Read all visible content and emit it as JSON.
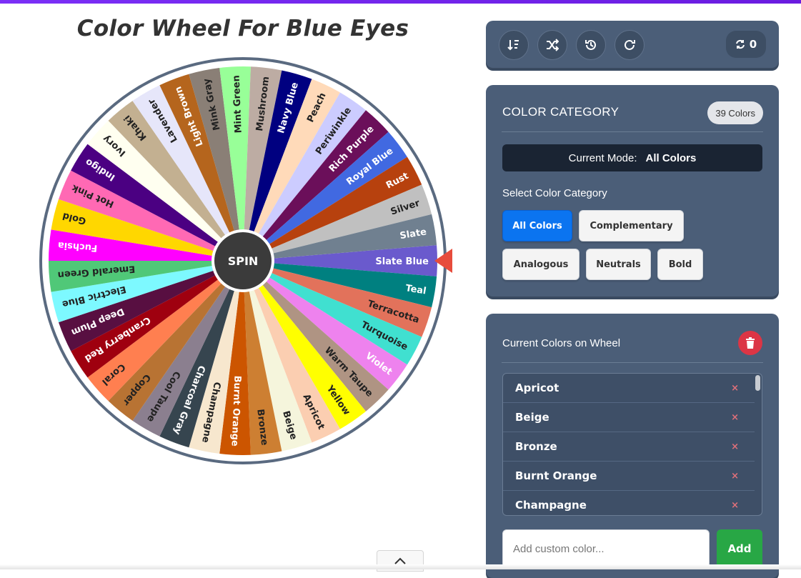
{
  "page": {
    "title": "Color Wheel For Blue Eyes"
  },
  "wheel": {
    "spin_label": "SPIN",
    "segments": [
      {
        "label": "Slate Blue",
        "color": "#6a5acd",
        "text": "#ffffff"
      },
      {
        "label": "Teal",
        "color": "#008080",
        "text": "#ffffff"
      },
      {
        "label": "Terracotta",
        "color": "#e2725b",
        "text": "#222222"
      },
      {
        "label": "Turquoise",
        "color": "#40e0d0",
        "text": "#222222"
      },
      {
        "label": "Violet",
        "color": "#ee82ee",
        "text": "#ffffff"
      },
      {
        "label": "Warm Taupe",
        "color": "#af9483",
        "text": "#222222"
      },
      {
        "label": "Yellow",
        "color": "#ffff00",
        "text": "#222222"
      },
      {
        "label": "Apricot",
        "color": "#fbceb1",
        "text": "#222222"
      },
      {
        "label": "Beige",
        "color": "#f5f5dc",
        "text": "#222222"
      },
      {
        "label": "Bronze",
        "color": "#cd7f32",
        "text": "#222222"
      },
      {
        "label": "Burnt Orange",
        "color": "#cc5500",
        "text": "#ffffff"
      },
      {
        "label": "Champagne",
        "color": "#f7e7ce",
        "text": "#222222"
      },
      {
        "label": "Charcoal Gray",
        "color": "#36454f",
        "text": "#ffffff"
      },
      {
        "label": "Cool Taupe",
        "color": "#8b7f8f",
        "text": "#222222"
      },
      {
        "label": "Copper",
        "color": "#b87333",
        "text": "#222222"
      },
      {
        "label": "Coral",
        "color": "#ff7f50",
        "text": "#222222"
      },
      {
        "label": "Cranberry Red",
        "color": "#9f000f",
        "text": "#ffffff"
      },
      {
        "label": "Deep Plum",
        "color": "#580f41",
        "text": "#ffffff"
      },
      {
        "label": "Electric Blue",
        "color": "#7df9ff",
        "text": "#222222"
      },
      {
        "label": "Emerald Green",
        "color": "#50c878",
        "text": "#222222"
      },
      {
        "label": "Fuchsia",
        "color": "#ff00ff",
        "text": "#ffffff"
      },
      {
        "label": "Gold",
        "color": "#ffd700",
        "text": "#222222"
      },
      {
        "label": "Hot Pink",
        "color": "#ff69b4",
        "text": "#222222"
      },
      {
        "label": "Indigo",
        "color": "#4b0082",
        "text": "#ffffff"
      },
      {
        "label": "Ivory",
        "color": "#fffff0",
        "text": "#222222"
      },
      {
        "label": "Khaki",
        "color": "#c3b091",
        "text": "#222222"
      },
      {
        "label": "Lavender",
        "color": "#e6e6fa",
        "text": "#222222"
      },
      {
        "label": "Light Brown",
        "color": "#b5651d",
        "text": "#ffffff"
      },
      {
        "label": "Mink Gray",
        "color": "#8a7f76",
        "text": "#222222"
      },
      {
        "label": "Mint Green",
        "color": "#98ff98",
        "text": "#222222"
      },
      {
        "label": "Mushroom",
        "color": "#bdaca3",
        "text": "#222222"
      },
      {
        "label": "Navy Blue",
        "color": "#000080",
        "text": "#ffffff"
      },
      {
        "label": "Peach",
        "color": "#ffdab9",
        "text": "#222222"
      },
      {
        "label": "Periwinkle",
        "color": "#ccccff",
        "text": "#222222"
      },
      {
        "label": "Rich Purple",
        "color": "#6b0f5a",
        "text": "#ffffff"
      },
      {
        "label": "Royal Blue",
        "color": "#4169e1",
        "text": "#ffffff"
      },
      {
        "label": "Rust",
        "color": "#b7410e",
        "text": "#ffffff"
      },
      {
        "label": "Silver",
        "color": "#c0c0c0",
        "text": "#222222"
      },
      {
        "label": "Slate",
        "color": "#708090",
        "text": "#ffffff"
      }
    ]
  },
  "toolbar": {
    "spin_count": "0"
  },
  "category": {
    "title": "COLOR CATEGORY",
    "badge": "39 Colors",
    "mode_prefix": "Current Mode:",
    "mode_value": "All Colors",
    "select_label": "Select Color Category",
    "buttons": [
      "All Colors",
      "Complementary",
      "Analogous",
      "Neutrals",
      "Bold"
    ]
  },
  "current_colors": {
    "title": "Current Colors on Wheel",
    "items": [
      "Apricot",
      "Beige",
      "Bronze",
      "Burnt Orange",
      "Champagne"
    ],
    "remove_glyph": "×",
    "input_placeholder": "Add custom color...",
    "add_label": "Add"
  }
}
